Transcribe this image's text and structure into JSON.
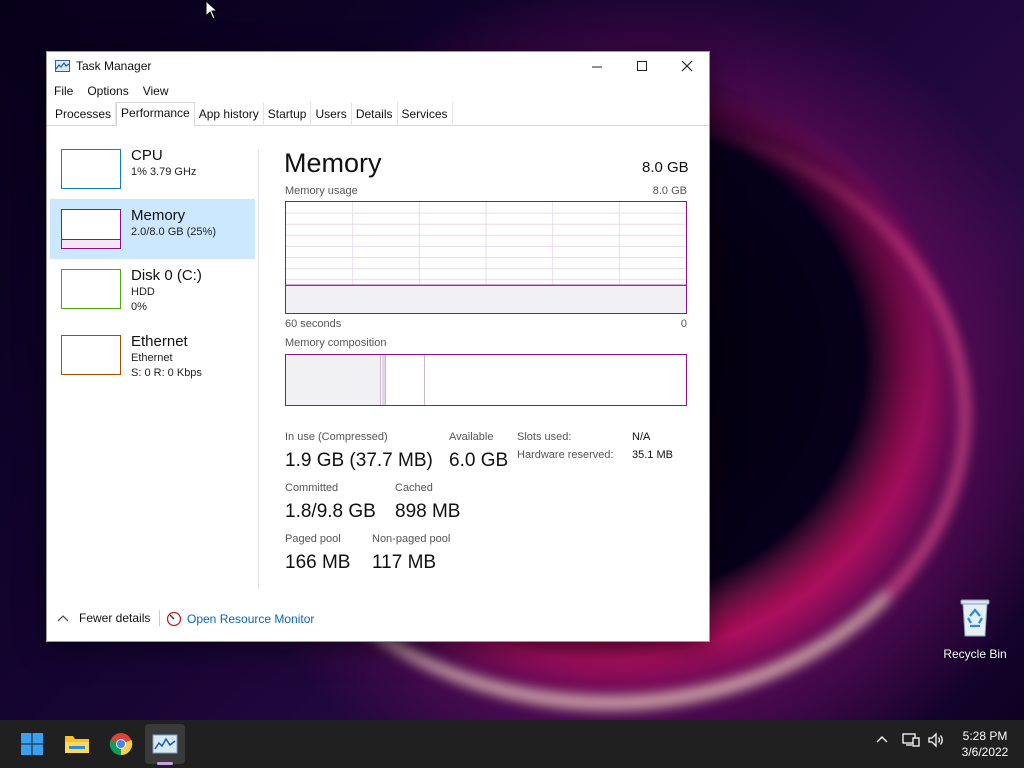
{
  "window": {
    "title": "Task Manager",
    "controls": {
      "minimize": "—",
      "maximize": "☐",
      "close": "✕"
    }
  },
  "menu": [
    "File",
    "Options",
    "View"
  ],
  "tabs": [
    "Processes",
    "Performance",
    "App history",
    "Startup",
    "Users",
    "Details",
    "Services"
  ],
  "active_tab": "Performance",
  "sidebar": {
    "items": [
      {
        "name": "CPU",
        "line1": "1% 3.79 GHz",
        "line2": "",
        "color": "#117dbb"
      },
      {
        "name": "Memory",
        "line1": "2.0/8.0 GB (25%)",
        "line2": "",
        "color": "#8b128b",
        "selected": true
      },
      {
        "name": "Disk 0 (C:)",
        "line1": "HDD",
        "line2": "0%",
        "color": "#4da60c"
      },
      {
        "name": "Ethernet",
        "line1": "Ethernet",
        "line2": "S: 0 R: 0 Kbps",
        "color": "#a74f01"
      }
    ]
  },
  "memory": {
    "title": "Memory",
    "total": "8.0 GB",
    "usage_label": "Memory usage",
    "usage_max": "8.0 GB",
    "time_left": "60 seconds",
    "time_right": "0",
    "composition_label": "Memory composition",
    "usage_fraction": 0.25,
    "stats": {
      "in_use_label": "In use (Compressed)",
      "in_use_value": "1.9 GB (37.7 MB)",
      "available_label": "Available",
      "available_value": "6.0 GB",
      "committed_label": "Committed",
      "committed_value": "1.8/9.8 GB",
      "cached_label": "Cached",
      "cached_value": "898 MB",
      "paged_label": "Paged pool",
      "paged_value": "166 MB",
      "nonpaged_label": "Non-paged pool",
      "nonpaged_value": "117 MB",
      "slots_label": "Slots used:",
      "slots_value": "N/A",
      "hw_reserved_label": "Hardware reserved:",
      "hw_reserved_value": "35.1 MB"
    }
  },
  "footer": {
    "fewer_details": "Fewer details",
    "open_resource_monitor": "Open Resource Monitor"
  },
  "desktop": {
    "recycle_bin": "Recycle Bin"
  },
  "taskbar": {
    "time": "5:28 PM",
    "date": "3/6/2022",
    "apps": [
      "start-icon",
      "file-explorer-icon",
      "chrome-icon",
      "task-manager-icon"
    ]
  }
}
